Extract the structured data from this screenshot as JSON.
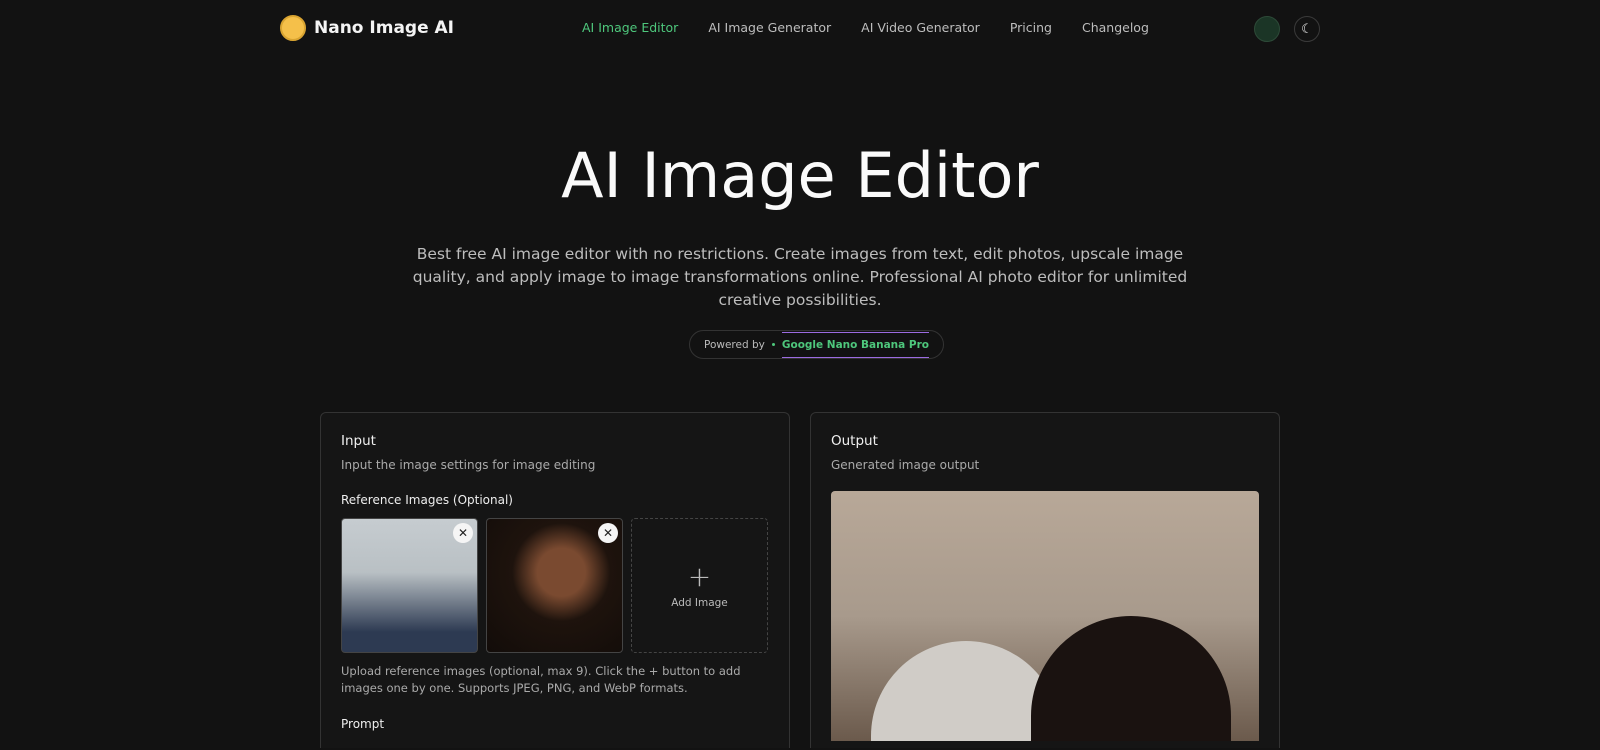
{
  "nav": {
    "logo": "Nano Image AI",
    "links": [
      "AI Image Editor",
      "AI Image Generator",
      "AI Video Generator",
      "Pricing",
      "Changelog"
    ],
    "active": "AI Image Editor"
  },
  "hero": {
    "title": "AI Image Editor",
    "subtitle": "Best free AI image editor with no restrictions. Create images from text, edit photos, upscale image quality, and apply image to image transformations online. Professional AI photo editor for unlimited creative possibilities.",
    "powered_by": "Powered by",
    "model": "Google Nano Banana Pro"
  },
  "input": {
    "title": "Input",
    "desc": "Input the image settings for image editing",
    "ref_label": "Reference Images (Optional)",
    "add_label": "Add Image",
    "help": "Upload reference images (optional, max 9). Click the + button to add images one by one. Supports JPEG, PNG, and WebP formats.",
    "prompt_label": "Prompt"
  },
  "output": {
    "title": "Output",
    "desc": "Generated image output"
  }
}
